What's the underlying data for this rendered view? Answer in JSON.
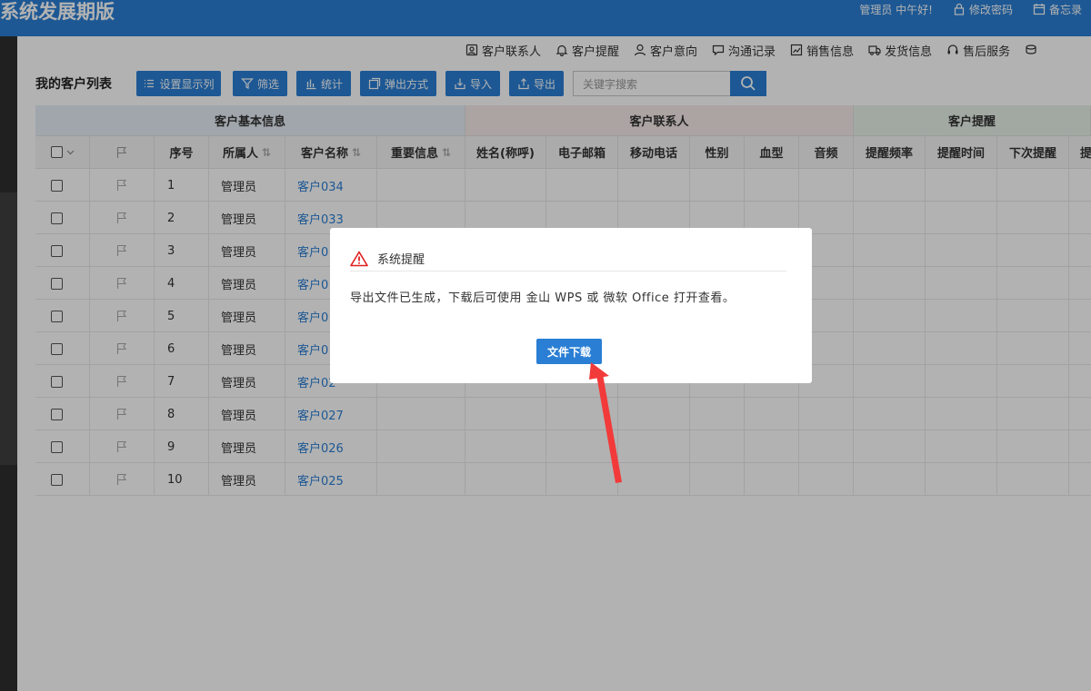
{
  "header": {
    "app_title": "系统发展期版",
    "greeting": "管理员 中午好!",
    "change_password": "修改密码",
    "memo": "备忘录"
  },
  "func_tabs": [
    {
      "label": "客户联系人",
      "icon": "contact-card-icon"
    },
    {
      "label": "客户提醒",
      "icon": "bell-icon"
    },
    {
      "label": "客户意向",
      "icon": "user-icon"
    },
    {
      "label": "沟通记录",
      "icon": "chat-icon"
    },
    {
      "label": "销售信息",
      "icon": "chart-card-icon"
    },
    {
      "label": "发货信息",
      "icon": "truck-icon"
    },
    {
      "label": "售后服务",
      "icon": "headset-icon"
    }
  ],
  "toolbar": {
    "list_title": "我的客户列表",
    "buttons": [
      "设置显示列",
      "筛选",
      "统计",
      "弹出方式",
      "导入",
      "导出"
    ],
    "search_placeholder": "关键字搜索"
  },
  "table": {
    "groups": [
      "客户基本信息",
      "客户联系人",
      "客户提醒"
    ],
    "columns": [
      "序号",
      "所属人",
      "客户名称",
      "重要信息",
      "姓名(称呼)",
      "电子邮箱",
      "移动电话",
      "性别",
      "血型",
      "音频",
      "提醒频率",
      "提醒时间",
      "下次提醒",
      "提"
    ],
    "rows": [
      {
        "no": "1",
        "owner": "管理员",
        "name": "客户034"
      },
      {
        "no": "2",
        "owner": "管理员",
        "name": "客户033"
      },
      {
        "no": "3",
        "owner": "管理员",
        "name": "客户0"
      },
      {
        "no": "4",
        "owner": "管理员",
        "name": "客户0"
      },
      {
        "no": "5",
        "owner": "管理员",
        "name": "客户0"
      },
      {
        "no": "6",
        "owner": "管理员",
        "name": "客户0"
      },
      {
        "no": "7",
        "owner": "管理员",
        "name": "客户02"
      },
      {
        "no": "8",
        "owner": "管理员",
        "name": "客户027"
      },
      {
        "no": "9",
        "owner": "管理员",
        "name": "客户026"
      },
      {
        "no": "10",
        "owner": "管理员",
        "name": "客户025"
      }
    ]
  },
  "dialog": {
    "title": "系统提醒",
    "message": "导出文件已生成，下载后可使用 金山 WPS 或 微软 Office 打开查看。",
    "download_label": "文件下载"
  },
  "colors": {
    "primary": "#2a7fd4",
    "arrow": "#f23a3a",
    "warning": "#e02020"
  }
}
